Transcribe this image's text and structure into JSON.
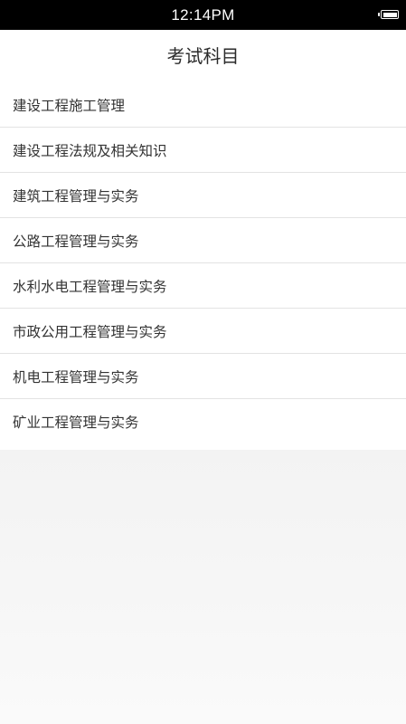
{
  "status_bar": {
    "time": "12:14PM",
    "battery_icon": "battery-full-icon"
  },
  "header": {
    "title": "考试科目"
  },
  "subjects": [
    {
      "label": "建设工程施工管理"
    },
    {
      "label": "建设工程法规及相关知识"
    },
    {
      "label": "建筑工程管理与实务"
    },
    {
      "label": "公路工程管理与实务"
    },
    {
      "label": "水利水电工程管理与实务"
    },
    {
      "label": "市政公用工程管理与实务"
    },
    {
      "label": "机电工程管理与实务"
    },
    {
      "label": "矿业工程管理与实务"
    }
  ],
  "colors": {
    "status_bar_bg": "#000000",
    "background": "#ffffff",
    "divider": "#e3e3e3",
    "text": "#333333"
  }
}
